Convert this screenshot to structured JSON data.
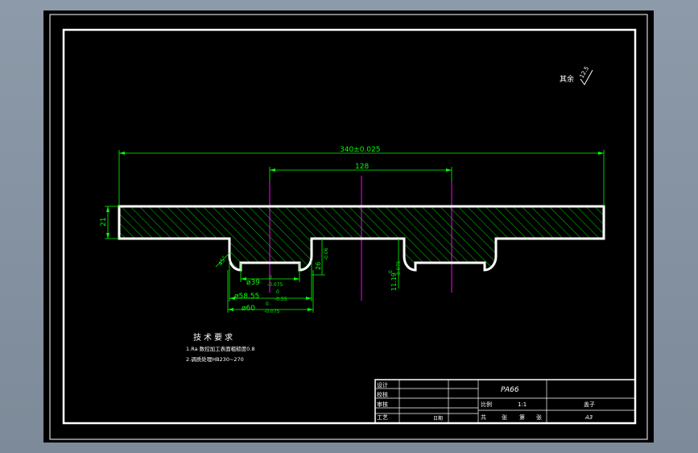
{
  "drawing": {
    "colors": {
      "background": "#000000",
      "outline": "#ffffff",
      "dimension": "#00ff00",
      "centerline": "#ff00ff",
      "hatch": "#00ff00"
    },
    "surface_note": {
      "label": "其余",
      "value": "12.5"
    },
    "dimensions": {
      "overall_length": "340±0.025",
      "center_distance": "128",
      "thickness": "21",
      "angle": "45°",
      "groove_depth": "26",
      "groove_depth_tol": "-0.06",
      "d1_value": "ø39",
      "d1_tol_top": "0",
      "d1_tol_bottom": "-0.075",
      "d2_value": "ø58.55",
      "d2_tol_top": "0",
      "d2_tol_bottom": "-0.55",
      "d3_value": "ø60",
      "d3_tol_top": "0",
      "d3_tol_bottom": "-0.075",
      "right_value": "11.19",
      "right_tol_top": "0",
      "right_tol_bottom": "-0.075"
    },
    "tech_requirements": {
      "title": "技术要求",
      "items": [
        "1.Ra 数控加工表面粗糙度0.8",
        "2.调质处理HB230~270"
      ]
    },
    "title_block": {
      "material": "PA66",
      "labels": {
        "design": "设计",
        "check": "校核",
        "review": "审核",
        "craft": "工艺",
        "date": "日期",
        "scale_label": "比例",
        "count_total": "共",
        "count_sheet": "张",
        "count_no": "第",
        "count_sheet2": "张"
      },
      "scale": "1:1",
      "part_name": "盖子",
      "sheet_size": "A3"
    }
  }
}
